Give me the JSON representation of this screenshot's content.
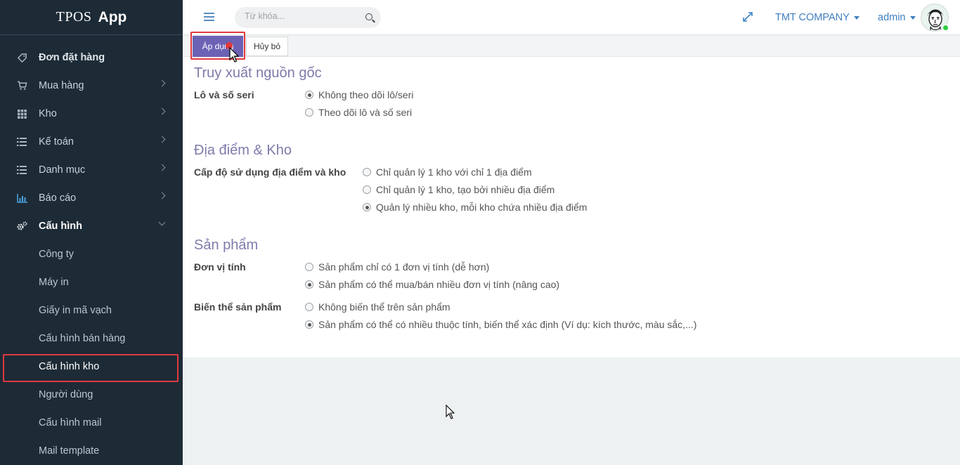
{
  "brand": {
    "part1": "TPOS",
    "part2": "App"
  },
  "sidebar": {
    "items": [
      {
        "label": "Đơn đặt hàng",
        "icon": "tag-icon",
        "chevron": false
      },
      {
        "label": "Mua hàng",
        "icon": "cart-icon",
        "chevron": true
      },
      {
        "label": "Kho",
        "icon": "grid-icon",
        "chevron": true
      },
      {
        "label": "Kế toán",
        "icon": "list-icon",
        "chevron": true
      },
      {
        "label": "Danh mục",
        "icon": "list-icon",
        "chevron": true
      },
      {
        "label": "Báo cáo",
        "icon": "bar-chart-icon",
        "chevron": true
      },
      {
        "label": "Cấu hình",
        "icon": "cogs-icon",
        "chevron": true
      }
    ],
    "sub_items": [
      "Công ty",
      "Máy in",
      "Giấy in mã vạch",
      "Cấu hình bán hàng",
      "Cấu hình kho",
      "Người dùng",
      "Cấu hình mail",
      "Mail template"
    ]
  },
  "topbar": {
    "search_placeholder": "Từ khóa...",
    "company": "TMT COMPANY",
    "user": "admin"
  },
  "actions": {
    "apply": "Áp dụng",
    "cancel": "Hủy bỏ"
  },
  "sections": {
    "traceability": {
      "title": "Truy xuất nguồn gốc",
      "label": "Lô và số seri",
      "options": [
        "Không theo dõi lô/seri",
        "Theo dõi lô và số seri"
      ],
      "selected": 0
    },
    "locations": {
      "title": "Địa điểm & Kho",
      "label": "Cấp độ sử dụng địa điểm và kho",
      "options": [
        "Chỉ quản lý 1 kho với chỉ 1 địa điểm",
        "Chỉ quản lý 1 kho, tạo bởi nhiều địa điểm",
        "Quản lý nhiều kho, mỗi kho chứa nhiều địa điểm"
      ],
      "selected": 2
    },
    "products": {
      "title": "Sản phẩm",
      "uom_label": "Đơn vị tính",
      "uom_options": [
        "Sản phẩm chỉ có 1 đơn vị tính (dễ hơn)",
        "Sản phẩm có thể mua/bán nhiều đơn vị tính (nâng cao)"
      ],
      "uom_selected": 1,
      "variant_label": "Biến thể sản phẩm",
      "variant_options": [
        "Không biến thể trên sản phẩm",
        "Sản phẩm có thể có nhiều thuộc tính, biến thể xác định (Ví dụ: kích thước, màu sắc,...)"
      ],
      "variant_selected": 1
    }
  }
}
